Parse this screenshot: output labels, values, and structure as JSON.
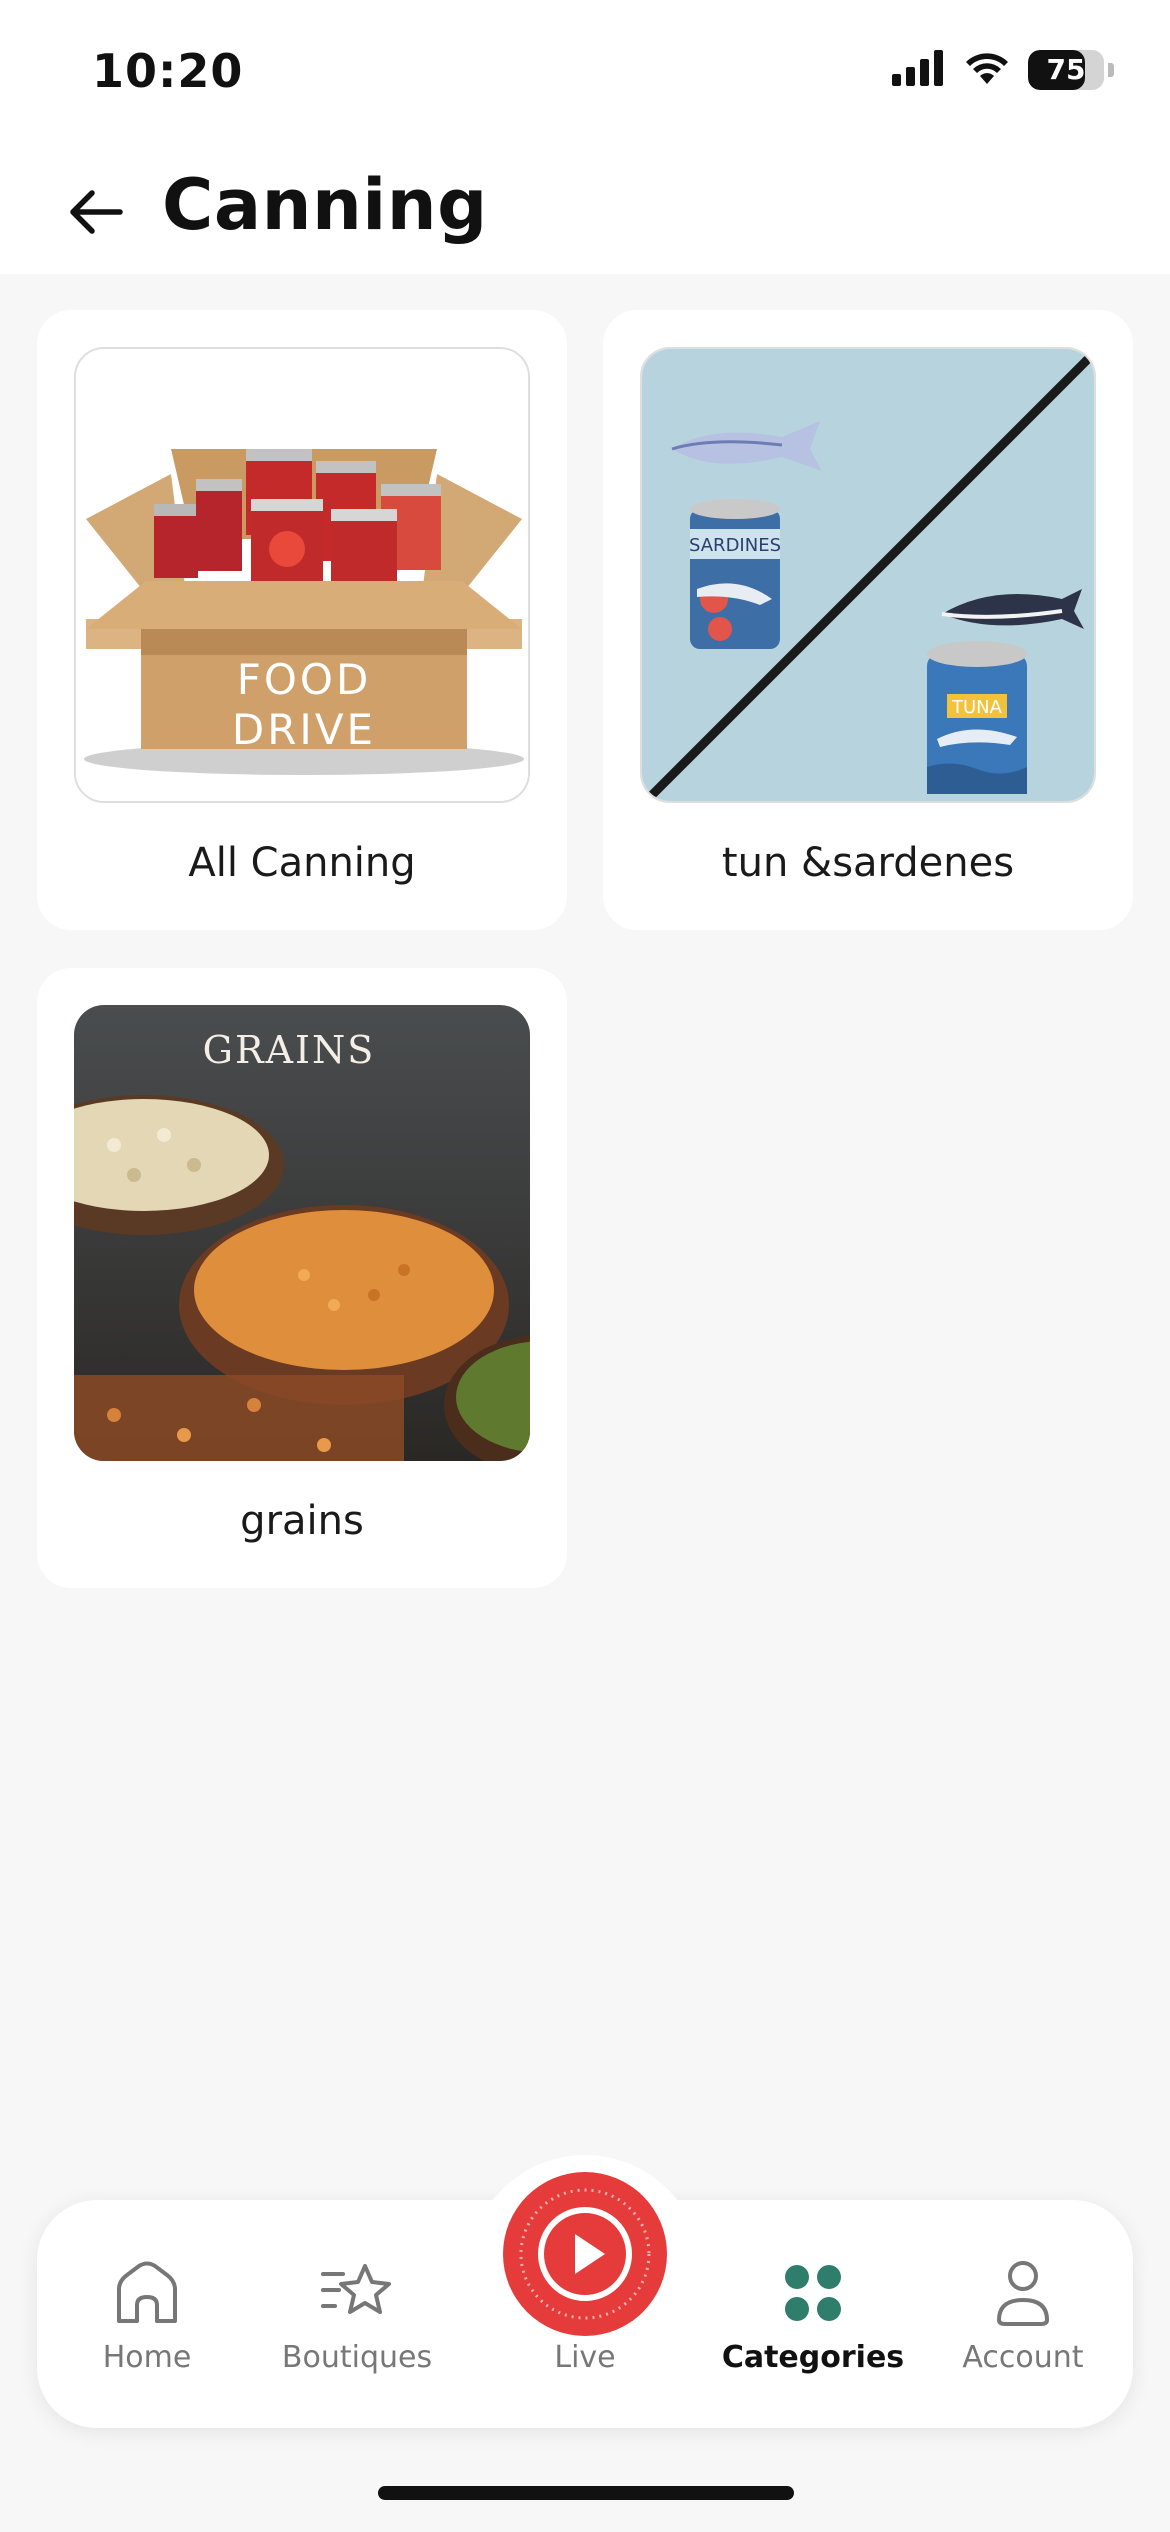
{
  "status_bar": {
    "time": "10:20",
    "battery_level": "75",
    "battery_fraction": 0.75,
    "icons": [
      "cellular-signal-icon",
      "wifi-icon",
      "battery-icon"
    ]
  },
  "header": {
    "title": "Canning",
    "back_icon": "arrow-left-icon"
  },
  "categories": [
    {
      "label": "All Canning",
      "image": "food-drive-box-of-cans",
      "image_text": [
        "FOOD",
        "DRIVE"
      ]
    },
    {
      "label": "tun &sardenes",
      "image": "sardines-and-tuna-cans",
      "image_text": [
        "SARDINES",
        "TUNA"
      ]
    },
    {
      "label": "grains",
      "image": "bowls-of-grains",
      "image_text": [
        "GRAINS"
      ]
    }
  ],
  "bottom_nav": {
    "items": [
      {
        "label": "Home",
        "icon": "home-icon",
        "active": false
      },
      {
        "label": "Boutiques",
        "icon": "star-icon",
        "active": false
      },
      {
        "label": "Live",
        "icon": "play-icon",
        "active": false
      },
      {
        "label": "Categories",
        "icon": "four-dots-grid-icon",
        "active": true
      },
      {
        "label": "Account",
        "icon": "user-icon",
        "active": false
      }
    ]
  },
  "colors": {
    "accent_live": "#e53b3b",
    "categories_icon": "#2f7e6c",
    "background": "#f7f7f7"
  }
}
